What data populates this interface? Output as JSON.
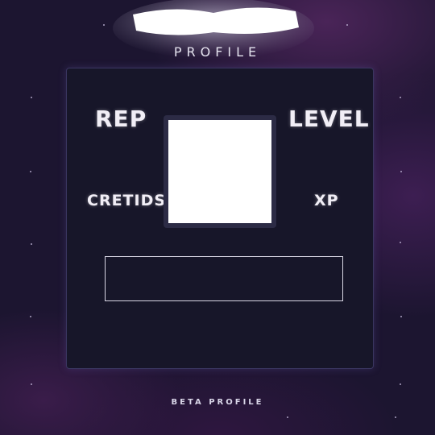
{
  "header": {
    "title": "PROFILE"
  },
  "stats": {
    "rep_label": "REP",
    "level_label": "LEVEL",
    "credits_label": "CRETIDS",
    "xp_label": "XP"
  },
  "footer": {
    "text": "BETA PROFILE"
  },
  "colors": {
    "background": "#1c1530",
    "card": "#171629",
    "card_border": "#3a3660",
    "text": "#f1eef6"
  }
}
